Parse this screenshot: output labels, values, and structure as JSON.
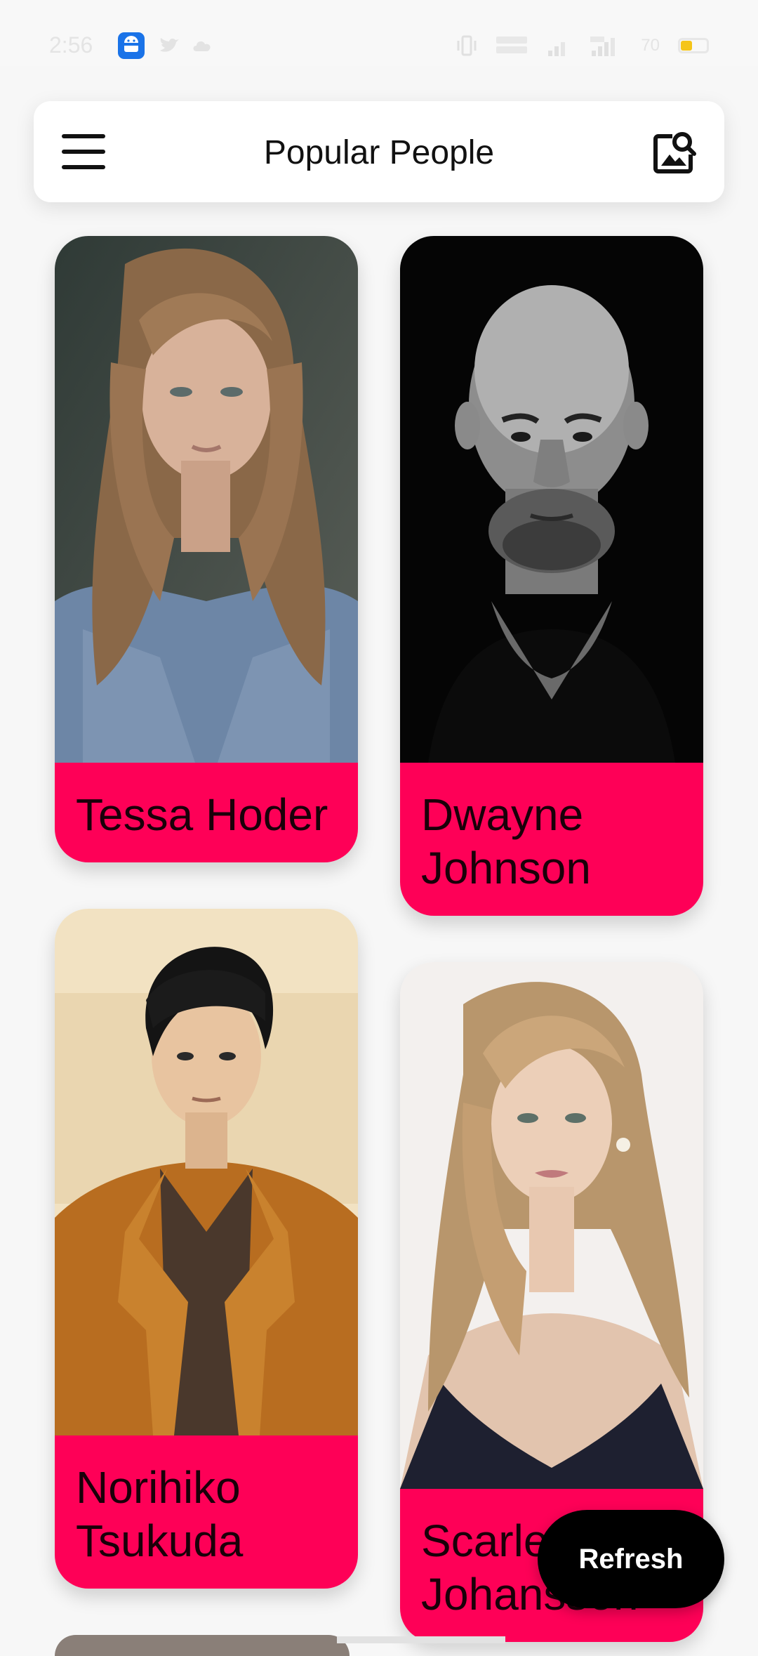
{
  "status_bar": {
    "time": "2:56",
    "battery_text": "70",
    "battery_level": 0.45,
    "notification_icons": [
      "android-icon",
      "twitter-icon",
      "cloud-icon"
    ],
    "signal_icons": [
      "vibrate-icon",
      "data-speed-icon",
      "signal-icon",
      "signal-icon"
    ],
    "colors": {
      "android_icon": "#1a73e8",
      "battery_fill": "#f5c518"
    }
  },
  "app_bar": {
    "title": "Popular People",
    "menu_icon": "hamburger-menu-icon",
    "action_icon": "image-search-icon"
  },
  "people": [
    {
      "name": "Tessa Hoder",
      "photo": "portrait-woman-long-hair-denim"
    },
    {
      "name": "Dwayne Johnson",
      "photo": "portrait-bald-man-black-background"
    },
    {
      "name": "Norihiko Tsukuda",
      "photo": "portrait-man-brown-jacket"
    },
    {
      "name": "Scarlett Johansson",
      "photo": "portrait-woman-blonde-hair"
    }
  ],
  "refresh_button": {
    "label": "Refresh"
  },
  "colors": {
    "card_label_bg": "#fe0057",
    "card_label_text": "#1a0009",
    "background": "#f7f7f7",
    "fab_bg": "#000000"
  }
}
